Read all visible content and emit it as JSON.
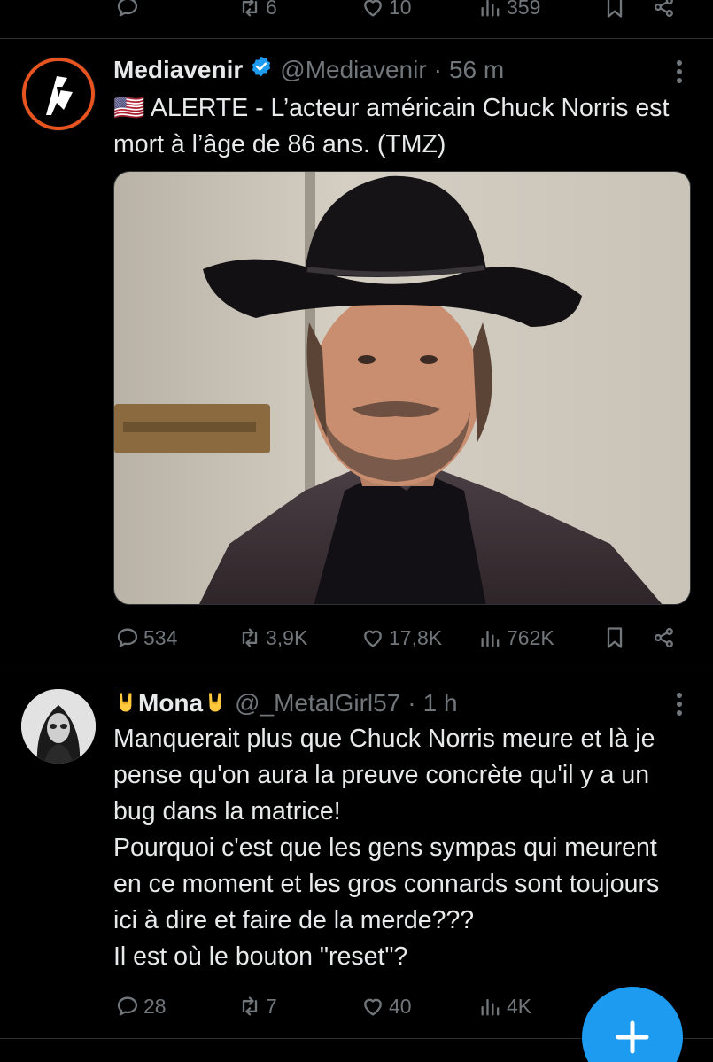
{
  "prev_tweet": {
    "actions": {
      "replies": "",
      "reposts": "6",
      "likes": "10",
      "views": "359"
    }
  },
  "tweet1": {
    "author_name": "Mediavenir",
    "verified": true,
    "handle": "@Mediavenir",
    "separator": "·",
    "time": "56 m",
    "flag": "🇺🇸",
    "text": "ALERTE - L’acteur américain Chuck Norris est mort à l’âge de 86 ans. (TMZ)",
    "actions": {
      "replies": "534",
      "reposts": "3,9K",
      "likes": "17,8K",
      "views": "762K"
    }
  },
  "tweet2": {
    "author_name": "Mona",
    "handle": "@_MetalGirl57",
    "separator": "·",
    "time": "1 h",
    "text": "Manquerait plus que Chuck Norris meure et là je pense qu'on aura la preuve concrète qu'il y a un bug dans la matrice!\nPourquoi c'est que les gens sympas qui meurent en ce moment et les gros connards sont toujours ici à dire et faire de la merde???\nIl est où le bouton \"reset\"?",
    "actions": {
      "replies": "28",
      "reposts": "7",
      "likes": "40",
      "views": "4K"
    }
  },
  "icons": {
    "reply": "reply-icon",
    "repost": "repost-icon",
    "like": "like-icon",
    "views": "views-icon",
    "bookmark": "bookmark-icon",
    "share": "share-icon",
    "more": "more-options-icon",
    "compose": "compose-plus-icon"
  },
  "colors": {
    "background": "#000000",
    "text": "#e7e9ea",
    "secondary": "#71767b",
    "accent": "#1d9bf0",
    "divider": "#2f3336",
    "mediavenir_orange": "#e8541f"
  }
}
